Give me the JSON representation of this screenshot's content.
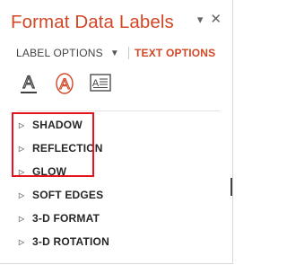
{
  "pane": {
    "title": "Format Data Labels",
    "pin_glyph": "▾",
    "close_glyph": "✕"
  },
  "tabs": {
    "label_options": "LABEL OPTIONS",
    "caret": "▼",
    "text_options": "TEXT OPTIONS"
  },
  "icons": [
    {
      "name": "text-fill-outline-icon",
      "color": "#404040"
    },
    {
      "name": "text-effects-icon",
      "color": "#d24726"
    },
    {
      "name": "text-box-icon",
      "color": "#404040"
    }
  ],
  "sections": [
    {
      "label": "SHADOW",
      "glyph": "▷"
    },
    {
      "label": "REFLECTION",
      "glyph": "▷"
    },
    {
      "label": "GLOW",
      "glyph": "▷"
    },
    {
      "label": "SOFT EDGES",
      "glyph": "▷"
    },
    {
      "label": "3-D FORMAT",
      "glyph": "▷"
    },
    {
      "label": "3-D ROTATION",
      "glyph": "▷"
    }
  ],
  "highlight_color": "#e8141d"
}
